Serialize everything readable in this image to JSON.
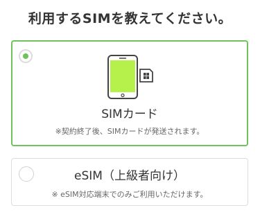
{
  "header": {
    "title": "利用するSIMを教えてください。"
  },
  "options": [
    {
      "id": "sim",
      "selected": true,
      "icon": "phone-with-sim-card",
      "label": "SIMカード",
      "note": "※契約終了後、SIMカードが発送されます。"
    },
    {
      "id": "esim",
      "selected": false,
      "label": "eSIM（上級者向け）",
      "note": "※ eSIM対応端末でのみご利用いただけます。"
    }
  ],
  "colors": {
    "accent": "#6ec45a",
    "screen": "#b5f04b",
    "text": "#333333",
    "muted": "#666666",
    "border": "#dddddd"
  }
}
